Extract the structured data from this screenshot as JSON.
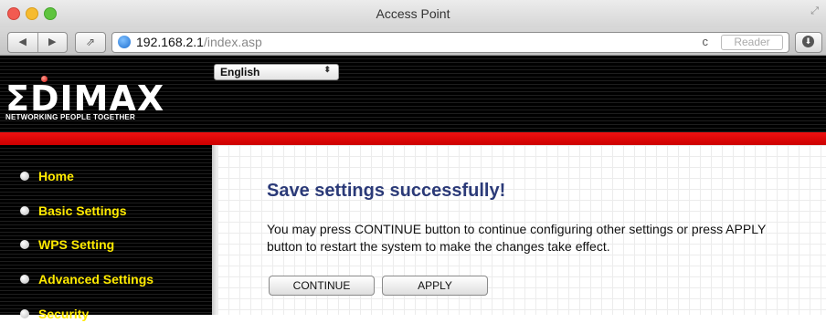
{
  "window": {
    "title": "Access Point"
  },
  "toolbar": {
    "back_icon": "back-arrow-icon",
    "forward_icon": "forward-arrow-icon",
    "url_host": "192.168.2.1",
    "url_path": "/index.asp",
    "reload_glyph": "c",
    "reader_label": "Reader"
  },
  "header": {
    "logo_text": "EDIMAX",
    "tagline": "NETWORKING PEOPLE TOGETHER",
    "language_selected": "English"
  },
  "sidebar": {
    "items": [
      {
        "label": "Home"
      },
      {
        "label": "Basic Settings"
      },
      {
        "label": "WPS Setting"
      },
      {
        "label": "Advanced Settings"
      },
      {
        "label": "Security"
      }
    ]
  },
  "main": {
    "title": "Save settings successfully!",
    "body": "You may press CONTINUE button to continue configuring other settings or press APPLY button to restart the system to make the changes take effect.",
    "continue_label": "CONTINUE",
    "apply_label": "APPLY"
  },
  "colors": {
    "accent_red": "#cc0000",
    "nav_yellow": "#ffea00",
    "title_blue": "#2b3a78"
  }
}
